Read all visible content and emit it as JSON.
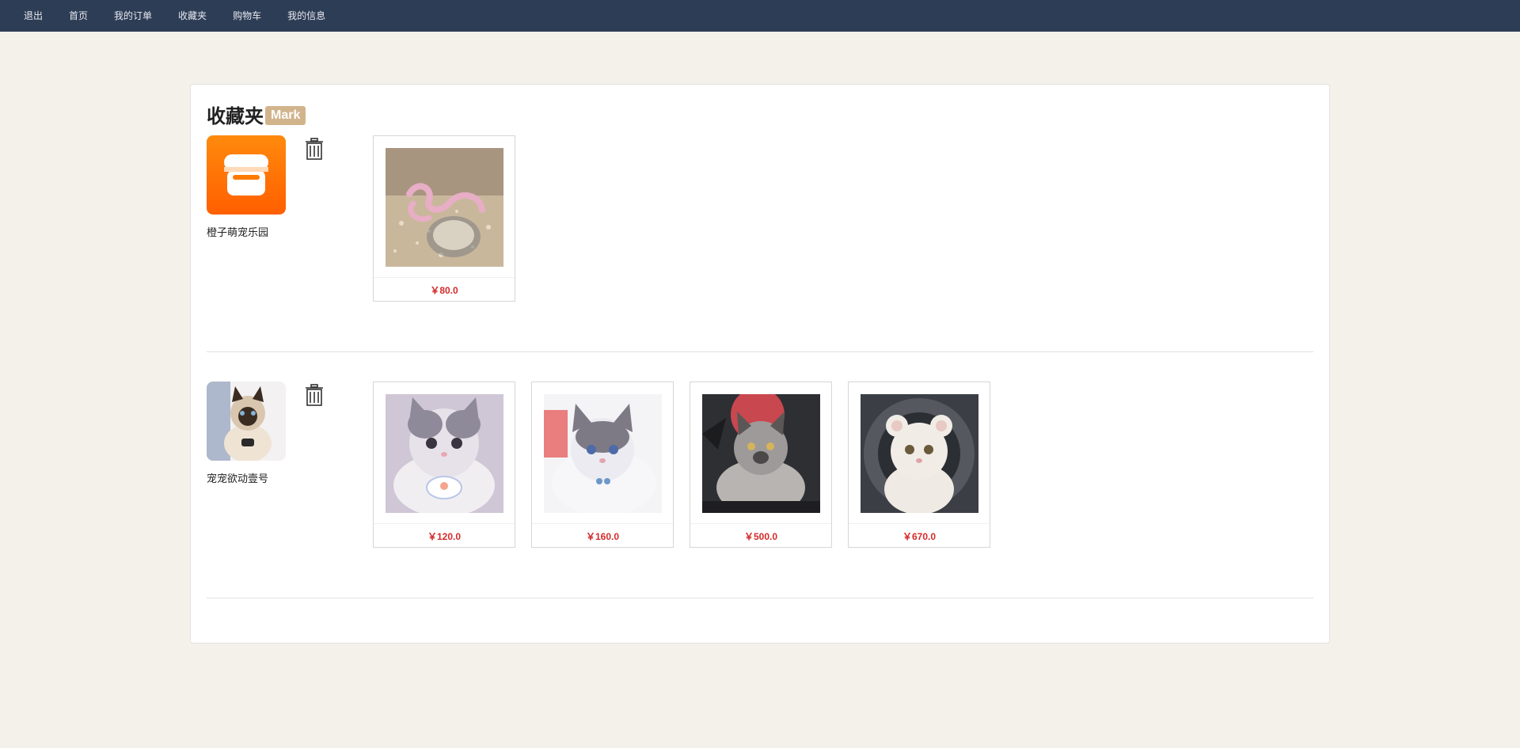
{
  "nav": {
    "items": [
      {
        "label": "退出"
      },
      {
        "label": "首页"
      },
      {
        "label": "我的订单"
      },
      {
        "label": "收藏夹"
      },
      {
        "label": "购物车"
      },
      {
        "label": "我的信息"
      }
    ]
  },
  "favorites": {
    "title": "收藏夹",
    "badge": "Mark",
    "stores": [
      {
        "name": "橙子萌宠乐园",
        "avatar_icon": "shop-icon",
        "products": [
          {
            "image": "snake-image",
            "price": "￥80.0"
          }
        ]
      },
      {
        "name": "宠宠欲动壹号",
        "avatar_icon": "cat-avatar",
        "products": [
          {
            "image": "cat-image",
            "price": "￥120.0"
          },
          {
            "image": "cat-image",
            "price": "￥160.0"
          },
          {
            "image": "cat-image",
            "price": "￥500.0"
          },
          {
            "image": "cat-image",
            "price": "￥670.0"
          }
        ]
      }
    ]
  },
  "colors": {
    "nav_bg": "#2e3d56",
    "page_bg": "#f4f1ea",
    "badge_bg": "#d2b48c",
    "price": "#d42a2a",
    "shop_icon_bg": "#ff7a00"
  }
}
